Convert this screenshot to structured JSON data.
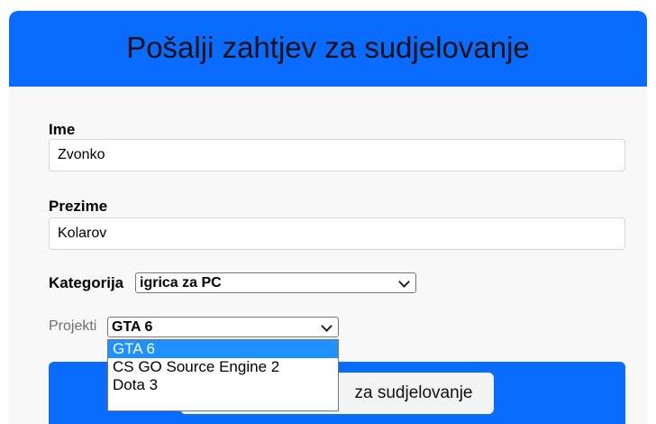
{
  "form": {
    "title": "Pošalji zahtjev za sudjelovanje",
    "ime_label": "Ime",
    "ime_value": "Zvonko",
    "prezime_label": "Prezime",
    "prezime_value": "Kolarov",
    "kategorija_label": "Kategorija",
    "kategorija_value": "igrica za PC",
    "projekti_label": "Projekti",
    "projekti_value": "GTA 6",
    "projekti_options": [
      "GTA 6",
      "CS GO Source Engine 2",
      "Dota 3"
    ],
    "submit_label": "Pošalji zahtjev za sudjelovanje",
    "submit_visible_text": "za sudjelovanje"
  },
  "colors": {
    "header_bg": "#0a6bff",
    "option_highlight": "#1e90ff"
  }
}
